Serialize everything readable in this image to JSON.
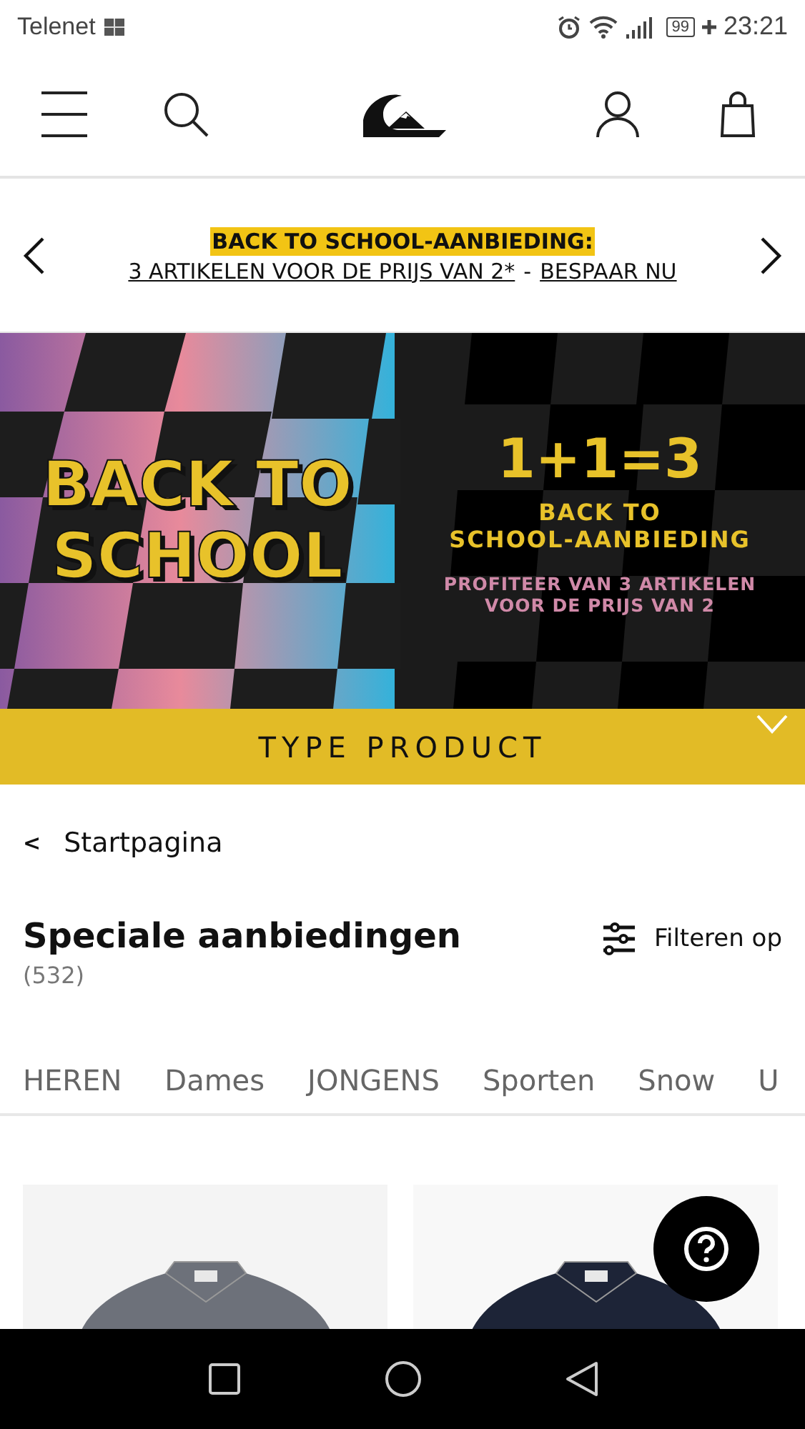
{
  "status_bar": {
    "carrier": "Telenet",
    "battery": "99",
    "time": "23:21"
  },
  "promo": {
    "headline": "BACK TO SCHOOL-AANBIEDING:",
    "offer_link": "3 ARTIKELEN VOOR DE PRIJS VAN 2*",
    "separator": "-",
    "cta_link": "BESPAAR NU"
  },
  "banner": {
    "title_lines": [
      "BACK TO",
      "SCHOOL"
    ],
    "equation": "1+1=3",
    "subtitle_lines": [
      "BACK TO",
      "SCHOOL-AANBIEDING"
    ],
    "detail_lines": [
      "PROFITEER VAN 3 ARTIKELEN",
      "VOOR DE PRIJS VAN 2"
    ]
  },
  "type_bar": {
    "label": "TYPE PRODUCT",
    "expanded": false
  },
  "breadcrumb": {
    "arrow": "<",
    "label": "Startpagina"
  },
  "heading": {
    "title": "Speciale aanbiedingen",
    "count": "(532)",
    "filter": "Filteren op"
  },
  "tabs": [
    {
      "label": "HEREN"
    },
    {
      "label": "Dames"
    },
    {
      "label": "JONGENS"
    },
    {
      "label": "Sporten"
    },
    {
      "label": "Snow"
    },
    {
      "label": "U"
    }
  ]
}
